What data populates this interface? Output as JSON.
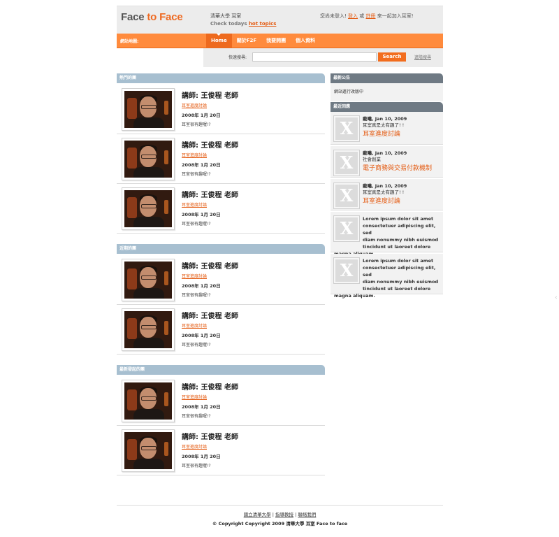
{
  "header": {
    "logo": {
      "part1": "Face ",
      "part2": "to",
      "part3": " Face"
    },
    "slogan_line1": "清華大學 耳室",
    "slogan_line2_prefix": "Check todays",
    "slogan_link": "hot topics",
    "login_prefix": "您尚未登入!",
    "login_link": "登入",
    "login_or": " 或 ",
    "register_link": "註冊",
    "login_suffix": " 來一起加入耳室!"
  },
  "nav": {
    "sitemap": "網站地圖:",
    "items": [
      {
        "label": "Home"
      },
      {
        "label": "關於F2F"
      },
      {
        "label": "我要開團"
      },
      {
        "label": "個人資料"
      }
    ]
  },
  "search": {
    "label": "快速搜尋:",
    "placeholder": "",
    "button": "Search",
    "advanced": "進階搜尋"
  },
  "sections": [
    {
      "title": "熱門的團",
      "items": [
        {
          "teacher": "講師: 王俊程 老師",
          "link": "耳室進度討論",
          "date": "2008年 1月 20日",
          "note": "耳室很有趣喔!?"
        },
        {
          "teacher": "講師: 王俊程 老師",
          "link": "耳室進度討論",
          "date": "2008年 1月 20日",
          "note": "耳室很有趣喔!?"
        },
        {
          "teacher": "講師: 王俊程 老師",
          "link": "耳室進度討論",
          "date": "2008年 1月 20日",
          "note": "耳室很有趣喔!?"
        }
      ]
    },
    {
      "title": "近期的團",
      "items": [
        {
          "teacher": "講師: 王俊程 老師",
          "link": "耳室進度討論",
          "date": "2008年 1月 20日",
          "note": "耳室很有趣喔!?"
        },
        {
          "teacher": "講師: 王俊程 老師",
          "link": "耳室進度討論",
          "date": "2008年 1月 20日",
          "note": "耳室很有趣喔!?"
        }
      ]
    },
    {
      "title": "最新發起的團",
      "items": [
        {
          "teacher": "講師: 王俊程 老師",
          "link": "耳室進度討論",
          "date": "2008年 1月 20日",
          "note": "耳室很有趣喔!?"
        },
        {
          "teacher": "講師: 王俊程 老師",
          "link": "耳室進度討論",
          "date": "2008年 1月 20日",
          "note": "耳室很有趣喔!?"
        }
      ]
    }
  ],
  "sidebar": {
    "announce_title": "最新公告",
    "announce_text": "網站進行改版中",
    "recent_title": "最近回應",
    "comments": [
      {
        "meta": "戴曦, Jan 10, 2009",
        "text": "耳室真是太有趣了! !",
        "topic": "耳室進度討論"
      },
      {
        "meta": "戴曦, Jan 10, 2009",
        "text": "社會創業",
        "topic": "電子商務與交易付款機制"
      },
      {
        "meta": "戴曦, Jan 10, 2009",
        "text": "耳室真是太有趣了! !",
        "topic": "耳室進度討論"
      }
    ],
    "lorem": [
      {
        "line1": "Lorem ipsum dolor sit amet",
        "line2": "consectetuer adipiscing elit, sed",
        "line3": "diam nonummy nibh euismod",
        "line4": "tincidunt ut laoreet dolore",
        "line5": "magna aliquam."
      },
      {
        "line1": "Lorem ipsum dolor sit amet",
        "line2": "consectetuer adipiscing elit, sed",
        "line3": "diam nonummy nibh euismod",
        "line4": "tincidunt ut laoreet dolore",
        "line5": "magna aliquam."
      }
    ],
    "thumb_glyph": "X"
  },
  "footer": {
    "link1": "國立清華大學",
    "sep": " | ",
    "link2": "指導教授",
    "link3": "聯絡我們",
    "copyright": "© Copyright Copyright 2009 清華大學 耳室 Face to face"
  },
  "colors": {
    "accent": "#ff8b3d",
    "link": "#e45b12",
    "section": "#a7bfd0",
    "sidebar_title": "#6f7a84"
  }
}
